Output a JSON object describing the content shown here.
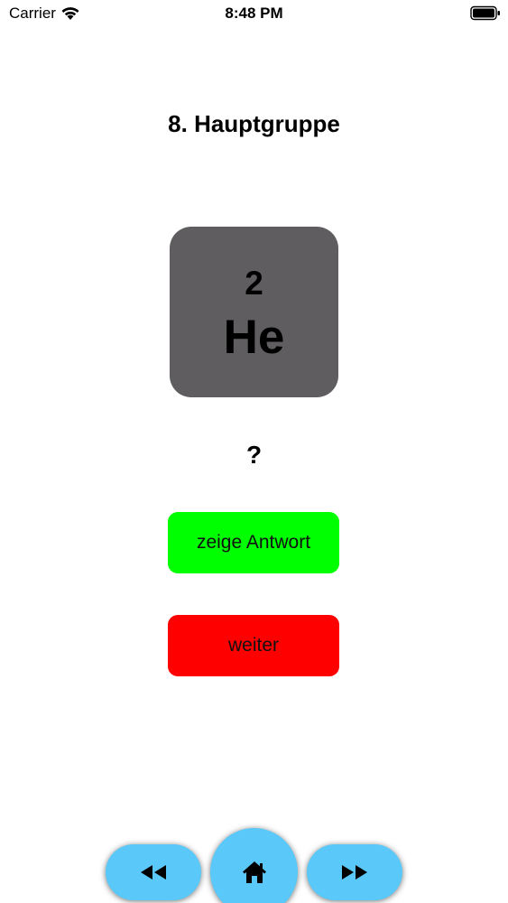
{
  "status_bar": {
    "carrier": "Carrier",
    "time": "8:48 PM"
  },
  "title": "8. Hauptgruppe",
  "element": {
    "atomic_number": "2",
    "symbol": "He"
  },
  "question": "?",
  "buttons": {
    "show_answer": "zeige Antwort",
    "next": "weiter"
  },
  "nav": {
    "prev_icon": "rewind-icon",
    "home_icon": "home-icon",
    "next_icon": "fast-forward-icon"
  },
  "colors": {
    "card": "#5f5d60",
    "answer_button": "#00ff00",
    "next_button": "#ff0000",
    "nav_button": "#5ac8f8"
  }
}
